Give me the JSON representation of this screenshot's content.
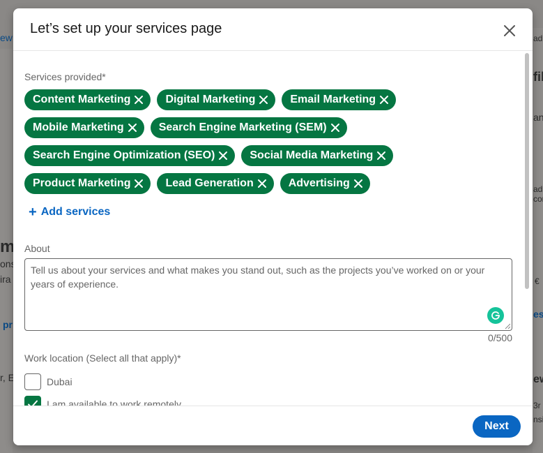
{
  "modal": {
    "title": "Let’s set up your services page",
    "services_label": "Services provided*",
    "services": [
      "Content Marketing",
      "Digital Marketing",
      "Email Marketing",
      "Mobile Marketing",
      "Search Engine Marketing (SEM)",
      "Search Engine Optimization (SEO)",
      "Social Media Marketing",
      "Product Marketing",
      "Lead Generation",
      "Advertising"
    ],
    "add_services_label": "Add services",
    "about_label": "About",
    "about_placeholder": "Tell us about your services and what makes you stand out, such as the projects you’ve worked on or your years of experience.",
    "about_value": "",
    "char_counter": "0/500",
    "work_location_label": "Work location (Select all that apply)*",
    "locations": [
      {
        "label": "Dubai",
        "checked": false
      },
      {
        "label": "I am available to work remotely",
        "checked": true
      }
    ],
    "next_label": "Next"
  },
  "background_fragments": {
    "left_1": "ew",
    "left_2": "m",
    "left_3": "ons",
    "left_4": "ira",
    "left_5": "pr",
    "left_6": "r, E",
    "right_1": "ad",
    "right_2": "fil",
    "right_3": "ang",
    "right_4": "ads",
    "right_5": "con",
    "right_6": "€",
    "right_7": "es",
    "right_8": "ew",
    "right_9": "3r",
    "right_10": "nsi"
  },
  "colors": {
    "chip_green": "#057642",
    "link_blue": "#0a66c2",
    "grammarly": "#15c39a"
  },
  "icons": {
    "close": "close-icon",
    "chip_remove": "x-icon",
    "add": "plus-icon",
    "grammarly": "grammarly-icon",
    "check": "checkmark-icon"
  }
}
